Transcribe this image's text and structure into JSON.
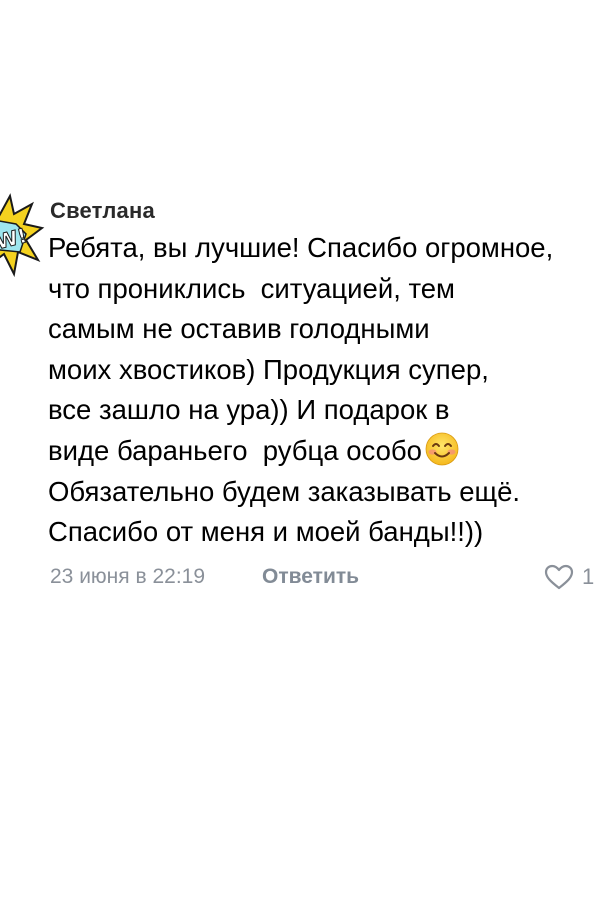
{
  "comment": {
    "author": "Светлана",
    "lines": [
      "Ребята, вы лучшие! Спасибо огромное,",
      "что прониклись  ситуацией, тем",
      "самым не оставив голодными",
      "моих хвостиков) Продукция супер,",
      "все зашло на ура)) И подарок в",
      "виде бараньего  рубца особо",
      "Обязательно будем заказывать ещё.",
      "Спасибо от меня и моей банды!!))"
    ],
    "emoji": "smiling-face-emoji",
    "date": "23 июня в 22:19",
    "reply_label": "Ответить",
    "likes": "1"
  },
  "avatar": {
    "lettering": "W!"
  },
  "colors": {
    "meta": "#8a9099",
    "reply": "#828b96",
    "avatar_yellow": "#f4d21f",
    "avatar_cyan": "#9ee6ef"
  }
}
